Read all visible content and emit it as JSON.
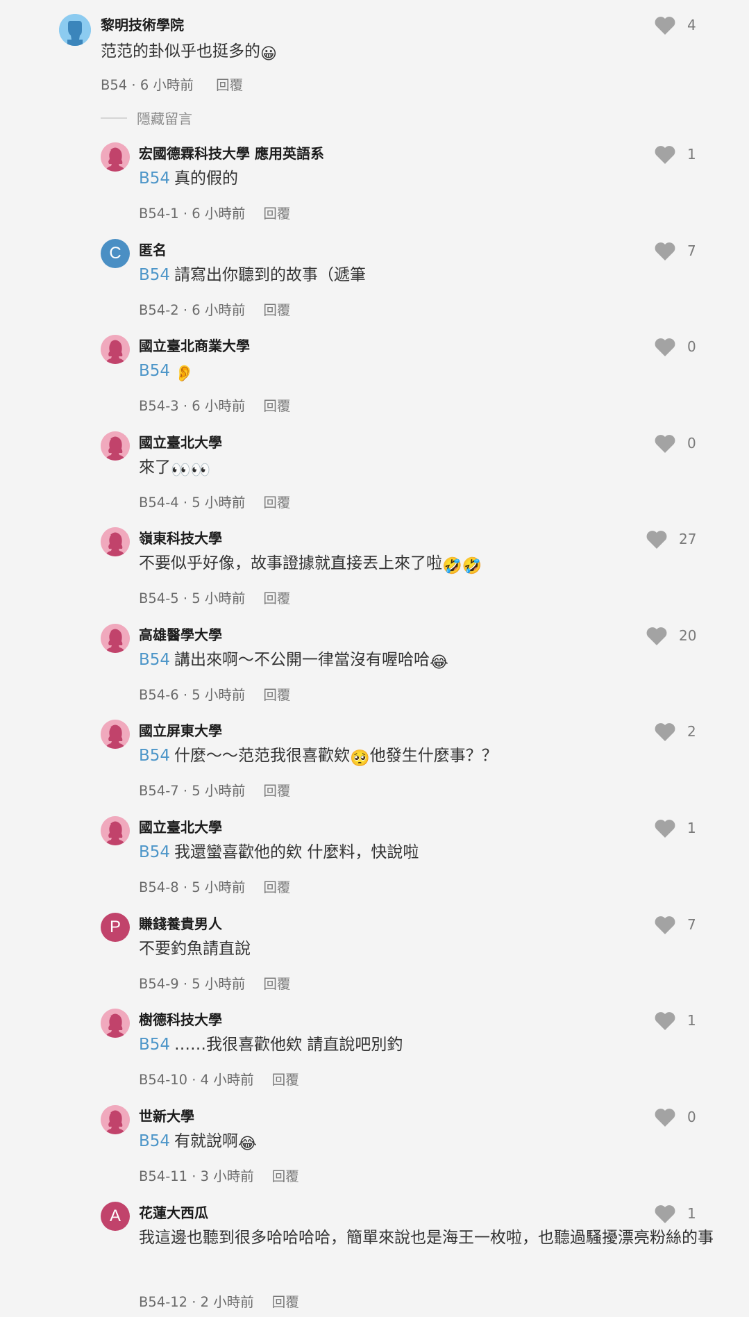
{
  "hide_replies_label": "隱藏留言",
  "comments": [
    {
      "name": "黎明技術學院",
      "tag": "",
      "body": "范范的卦似乎也挺多的",
      "emoji": "😀",
      "floor": "B54",
      "time": "6 小時前",
      "reply": "回覆",
      "likes": "4",
      "avatar": "male"
    },
    {
      "name": "宏國德霖科技大學 應用英語系",
      "tag": "B54",
      "body": "真的假的",
      "emoji": "",
      "floor": "B54-1",
      "time": "6 小時前",
      "reply": "回覆",
      "likes": "1",
      "avatar": "female"
    },
    {
      "name": "匿名",
      "tag": "B54",
      "body": "請寫出你聽到的故事（遞筆",
      "emoji": "",
      "floor": "B54-2",
      "time": "6 小時前",
      "reply": "回覆",
      "likes": "7",
      "avatar": "letter-c",
      "letter": "C"
    },
    {
      "name": "國立臺北商業大學",
      "tag": "B54",
      "body": "",
      "emoji": "👂",
      "floor": "B54-3",
      "time": "6 小時前",
      "reply": "回覆",
      "likes": "0",
      "avatar": "female"
    },
    {
      "name": "國立臺北大學",
      "tag": "",
      "body": "來了",
      "emoji": "👀👀",
      "floor": "B54-4",
      "time": "5 小時前",
      "reply": "回覆",
      "likes": "0",
      "avatar": "female"
    },
    {
      "name": "嶺東科技大學",
      "tag": "",
      "body": "不要似乎好像，故事證據就直接丟上來了啦",
      "emoji": "🤣🤣",
      "floor": "B54-5",
      "time": "5 小時前",
      "reply": "回覆",
      "likes": "27",
      "avatar": "female"
    },
    {
      "name": "高雄醫學大學",
      "tag": "B54",
      "body": "講出來啊～不公開一律當沒有喔哈哈",
      "emoji": "😂",
      "floor": "B54-6",
      "time": "5 小時前",
      "reply": "回覆",
      "likes": "20",
      "avatar": "female"
    },
    {
      "name": "國立屏東大學",
      "tag": "B54",
      "body": "什麼～～范范我很喜歡欸",
      "emoji": "🥺",
      "body2": "他發生什麼事？？",
      "floor": "B54-7",
      "time": "5 小時前",
      "reply": "回覆",
      "likes": "2",
      "avatar": "female"
    },
    {
      "name": "國立臺北大學",
      "tag": "B54",
      "body": "我還蠻喜歡他的欸 什麼料，快說啦",
      "emoji": "",
      "floor": "B54-8",
      "time": "5 小時前",
      "reply": "回覆",
      "likes": "1",
      "avatar": "female"
    },
    {
      "name": "賺錢養貴男人",
      "tag": "",
      "body": "不要釣魚請直說",
      "emoji": "",
      "floor": "B54-9",
      "time": "5 小時前",
      "reply": "回覆",
      "likes": "7",
      "avatar": "letter-p",
      "letter": "P"
    },
    {
      "name": "樹德科技大學",
      "tag": "B54",
      "body": "……我很喜歡他欸 請直說吧別釣",
      "emoji": "",
      "floor": "B54-10",
      "time": "4 小時前",
      "reply": "回覆",
      "likes": "1",
      "avatar": "female"
    },
    {
      "name": "世新大學",
      "tag": "B54",
      "body": "有就說啊",
      "emoji": "😂",
      "floor": "B54-11",
      "time": "3 小時前",
      "reply": "回覆",
      "likes": "0",
      "avatar": "female"
    },
    {
      "name": "花蓮大西瓜",
      "tag": "",
      "body": "我這邊也聽到很多哈哈哈哈，簡單來說也是海王一枚啦，也聽過騷擾漂亮粉絲的事",
      "emoji": "",
      "floor": "B54-12",
      "time": "2 小時前",
      "reply": "回覆",
      "likes": "1",
      "avatar": "letter-a",
      "letter": "A"
    }
  ]
}
